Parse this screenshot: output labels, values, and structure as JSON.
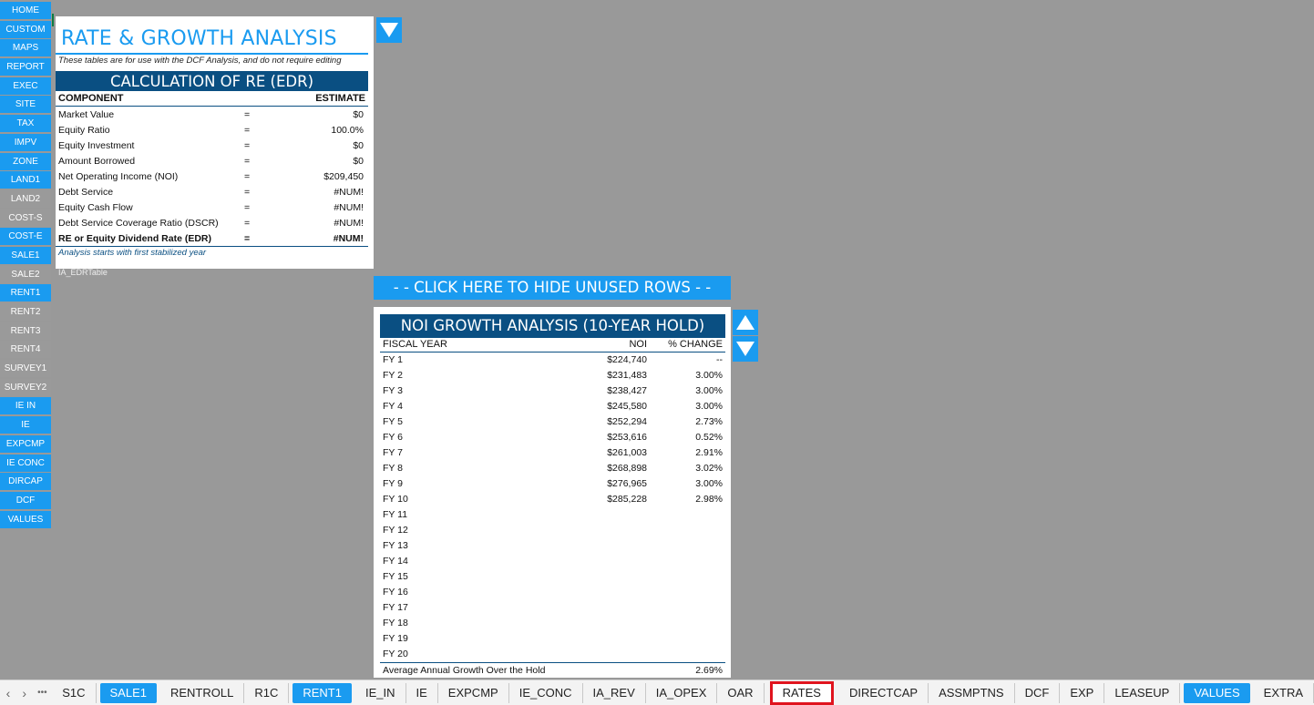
{
  "nav": [
    {
      "label": "HOME",
      "color": "blue"
    },
    {
      "label": "CUSTOM",
      "color": "blue"
    },
    {
      "label": "MAPS",
      "color": "blue"
    },
    {
      "label": "REPORT",
      "color": "blue"
    },
    {
      "label": "EXEC",
      "color": "blue"
    },
    {
      "label": "SITE",
      "color": "blue"
    },
    {
      "label": "TAX",
      "color": "blue"
    },
    {
      "label": "IMPV",
      "color": "blue"
    },
    {
      "label": "ZONE",
      "color": "blue"
    },
    {
      "label": "LAND1",
      "color": "blue"
    },
    {
      "label": "LAND2",
      "color": "grey"
    },
    {
      "label": "COST-S",
      "color": "grey"
    },
    {
      "label": "COST-E",
      "color": "blue"
    },
    {
      "label": "SALE1",
      "color": "blue"
    },
    {
      "label": "SALE2",
      "color": "grey"
    },
    {
      "label": "RENT1",
      "color": "blue"
    },
    {
      "label": "RENT2",
      "color": "grey"
    },
    {
      "label": "RENT3",
      "color": "grey"
    },
    {
      "label": "RENT4",
      "color": "grey"
    },
    {
      "label": "SURVEY1",
      "color": "grey"
    },
    {
      "label": "SURVEY2",
      "color": "grey"
    },
    {
      "label": "IE IN",
      "color": "blue"
    },
    {
      "label": "IE",
      "color": "blue"
    },
    {
      "label": "EXPCMP",
      "color": "blue"
    },
    {
      "label": "IE CONC",
      "color": "blue"
    },
    {
      "label": "DIRCAP",
      "color": "blue"
    },
    {
      "label": "DCF",
      "color": "blue"
    },
    {
      "label": "VALUES",
      "color": "blue"
    }
  ],
  "edr": {
    "title": "RATE & GROWTH ANALYSIS",
    "subtitle": "These tables are for use with the DCF Analysis, and do not require editing",
    "band": "CALCULATION OF RE (EDR)",
    "col_component": "COMPONENT",
    "col_estimate": "ESTIMATE",
    "rows": [
      {
        "label": "Market Value",
        "eq": "=",
        "value": "$0"
      },
      {
        "label": "Equity Ratio",
        "eq": "=",
        "value": "100.0%"
      },
      {
        "label": "Equity Investment",
        "eq": "=",
        "value": "$0"
      },
      {
        "label": "Amount Borrowed",
        "eq": "=",
        "value": "$0"
      },
      {
        "label": "Net Operating Income (NOI)",
        "eq": "=",
        "value": "$209,450"
      },
      {
        "label": "Debt Service",
        "eq": "=",
        "value": "#NUM!"
      },
      {
        "label": "Equity Cash Flow",
        "eq": "=",
        "value": "#NUM!"
      },
      {
        "label": "Debt Service Coverage Ratio (DSCR)",
        "eq": "=",
        "value": "#NUM!"
      },
      {
        "label": "RE or Equity Dividend Rate (EDR)",
        "eq": "=",
        "value": "#NUM!",
        "bold": true
      }
    ],
    "note": "Analysis starts with first stabilized year",
    "named_range": "IA_EDRTable"
  },
  "hide_button": "- - CLICK HERE TO HIDE UNUSED ROWS - -",
  "noi": {
    "band": "NOI GROWTH ANALYSIS (10-YEAR HOLD)",
    "col_year": "FISCAL YEAR",
    "col_noi": "NOI",
    "col_change": "% CHANGE",
    "rows": [
      {
        "fy": "FY 1",
        "noi": "$224,740",
        "pct": "--"
      },
      {
        "fy": "FY 2",
        "noi": "$231,483",
        "pct": "3.00%"
      },
      {
        "fy": "FY 3",
        "noi": "$238,427",
        "pct": "3.00%"
      },
      {
        "fy": "FY 4",
        "noi": "$245,580",
        "pct": "3.00%"
      },
      {
        "fy": "FY 5",
        "noi": "$252,294",
        "pct": "2.73%"
      },
      {
        "fy": "FY 6",
        "noi": "$253,616",
        "pct": "0.52%"
      },
      {
        "fy": "FY 7",
        "noi": "$261,003",
        "pct": "2.91%"
      },
      {
        "fy": "FY 8",
        "noi": "$268,898",
        "pct": "3.02%"
      },
      {
        "fy": "FY 9",
        "noi": "$276,965",
        "pct": "3.00%"
      },
      {
        "fy": "FY 10",
        "noi": "$285,228",
        "pct": "2.98%"
      },
      {
        "fy": "FY 11",
        "noi": "",
        "pct": ""
      },
      {
        "fy": "FY 12",
        "noi": "",
        "pct": ""
      },
      {
        "fy": "FY 13",
        "noi": "",
        "pct": ""
      },
      {
        "fy": "FY 14",
        "noi": "",
        "pct": ""
      },
      {
        "fy": "FY 15",
        "noi": "",
        "pct": ""
      },
      {
        "fy": "FY 16",
        "noi": "",
        "pct": ""
      },
      {
        "fy": "FY 17",
        "noi": "",
        "pct": ""
      },
      {
        "fy": "FY 18",
        "noi": "",
        "pct": ""
      },
      {
        "fy": "FY 19",
        "noi": "",
        "pct": ""
      },
      {
        "fy": "FY 20",
        "noi": "",
        "pct": ""
      }
    ],
    "footer_label": "Average Annual Growth Over the Hold",
    "footer_value": "2.69%"
  },
  "tabs": {
    "prev": "‹",
    "next": "›",
    "more": "•••",
    "items": [
      {
        "label": "S1C",
        "style": "plain"
      },
      {
        "label": "SALE1",
        "style": "blue"
      },
      {
        "label": "RENTROLL",
        "style": "plain"
      },
      {
        "label": "R1C",
        "style": "plain"
      },
      {
        "label": "RENT1",
        "style": "blue"
      },
      {
        "label": "IE_IN",
        "style": "plain"
      },
      {
        "label": "IE",
        "style": "plain"
      },
      {
        "label": "EXPCMP",
        "style": "plain"
      },
      {
        "label": "IE_CONC",
        "style": "plain"
      },
      {
        "label": "IA_REV",
        "style": "plain"
      },
      {
        "label": "IA_OPEX",
        "style": "plain"
      },
      {
        "label": "OAR",
        "style": "plain"
      },
      {
        "label": "RATES",
        "style": "active"
      },
      {
        "label": "DIRECTCAP",
        "style": "plain"
      },
      {
        "label": "ASSMPTNS",
        "style": "plain"
      },
      {
        "label": "DCF",
        "style": "plain"
      },
      {
        "label": "EXP",
        "style": "plain"
      },
      {
        "label": "LEASEUP",
        "style": "plain"
      },
      {
        "label": "VALUES",
        "style": "blue"
      },
      {
        "label": "EXTRA",
        "style": "plain"
      }
    ]
  },
  "colors": {
    "accent": "#1a9bf0",
    "band": "#0a4f82",
    "sheet_bg": "#999999",
    "active_tab_border": "#e0141e"
  }
}
